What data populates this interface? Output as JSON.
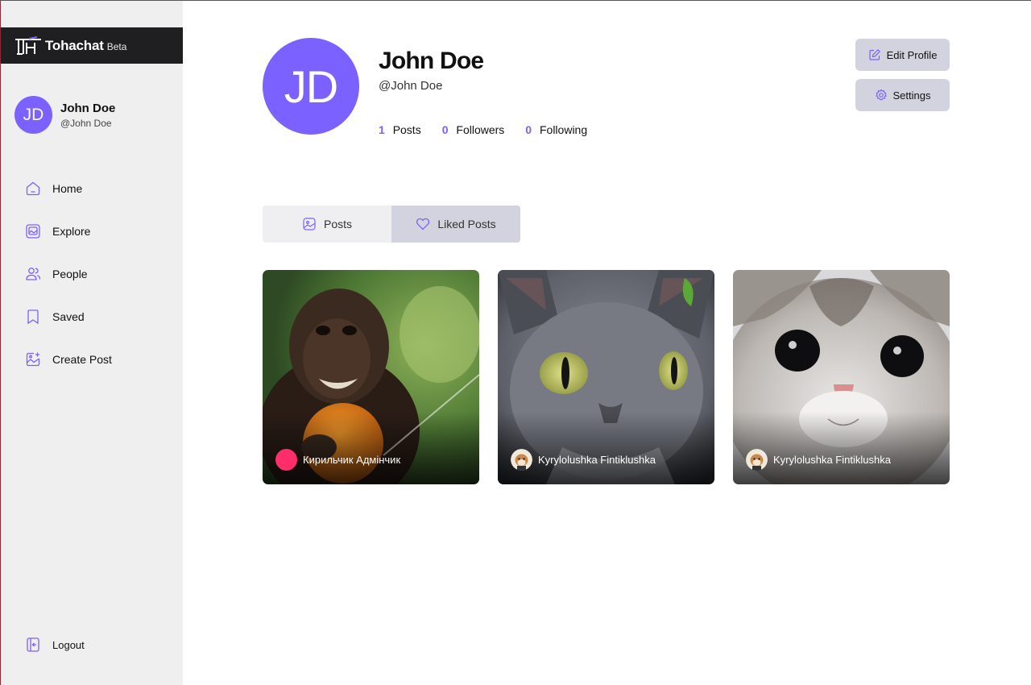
{
  "brand": {
    "name": "Tohachat",
    "badge": "Beta"
  },
  "sidebar_user": {
    "initials": "JD",
    "name": "John Doe",
    "handle": "@John Doe"
  },
  "nav": {
    "items": [
      {
        "label": "Home",
        "icon": "home-icon"
      },
      {
        "label": "Explore",
        "icon": "explore-icon"
      },
      {
        "label": "People",
        "icon": "people-icon"
      },
      {
        "label": "Saved",
        "icon": "bookmark-icon"
      },
      {
        "label": "Create Post",
        "icon": "image-plus-icon"
      }
    ],
    "logout_label": "Logout"
  },
  "profile": {
    "initials": "JD",
    "name": "John Doe",
    "handle": "@John Doe",
    "stats": [
      {
        "value": "1",
        "label": "Posts"
      },
      {
        "value": "0",
        "label": "Followers"
      },
      {
        "value": "0",
        "label": "Following"
      }
    ],
    "edit_label": "Edit Profile",
    "settings_label": "Settings"
  },
  "tabs": [
    {
      "label": "Posts",
      "active": false,
      "icon": "image-icon"
    },
    {
      "label": "Liked Posts",
      "active": true,
      "icon": "heart-icon"
    }
  ],
  "posts": [
    {
      "author": "Кирильчик Адмінчик",
      "subject": "monkey"
    },
    {
      "author": "Kyrylolushka Fintiklushka",
      "subject": "gray-cat"
    },
    {
      "author": "Kyrylolushka Fintiklushka",
      "subject": "kitten"
    }
  ],
  "colors": {
    "accent": "#7b61ff",
    "button_bg": "#d3d3e0",
    "sidebar_bg": "#efefef",
    "brand_bar": "#1f1f21"
  }
}
